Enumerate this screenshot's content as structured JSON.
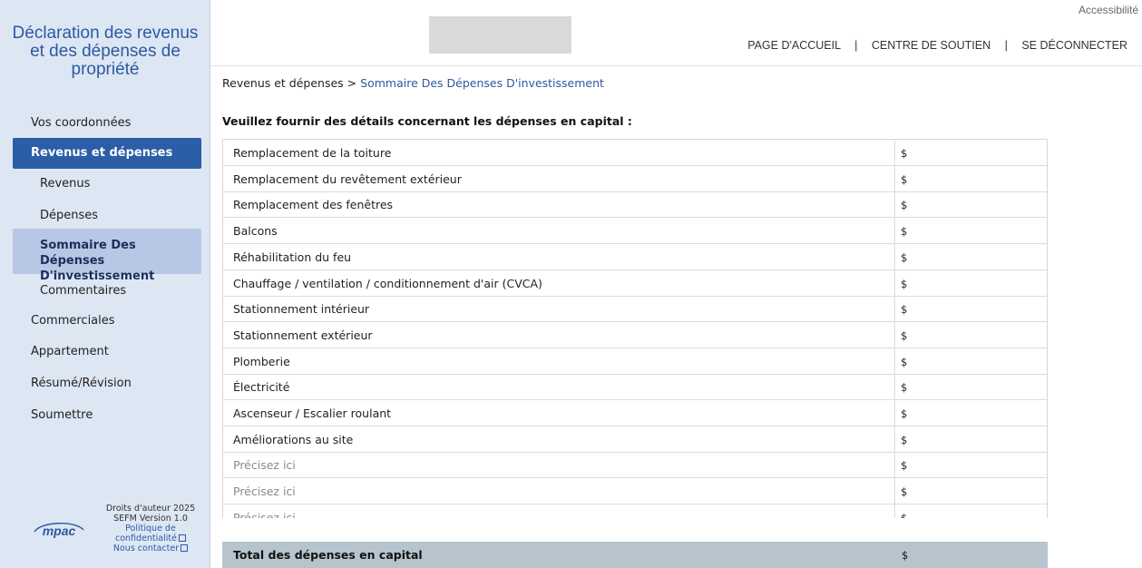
{
  "app": {
    "title_line1": "Déclaration des revenus",
    "title_line2": "et des dépenses de",
    "title_line3": "propriété"
  },
  "header": {
    "accessibility": "Accessibilité",
    "nav": [
      "PAGE D'ACCUEIL",
      "CENTRE DE SOUTIEN",
      "SE DÉCONNECTER"
    ],
    "separator": "|"
  },
  "sidebar": {
    "items": [
      {
        "label": "Vos coordonnées",
        "level": "top",
        "active": false
      },
      {
        "label": "Revenus et dépenses",
        "level": "top",
        "active": true
      },
      {
        "label": "Revenus",
        "level": "sub",
        "active": false
      },
      {
        "label": "Dépenses",
        "level": "sub",
        "active": false
      },
      {
        "label": "Sommaire Des Dépenses D'investissement",
        "level": "sub",
        "active": true
      },
      {
        "label": "Commentaires",
        "level": "sub",
        "active": false
      },
      {
        "label": "Commerciales",
        "level": "top",
        "active": false
      },
      {
        "label": "Appartement",
        "level": "top",
        "active": false
      },
      {
        "label": "Résumé/Révision",
        "level": "top",
        "active": false
      },
      {
        "label": "Soumettre",
        "level": "top",
        "active": false
      }
    ]
  },
  "footer": {
    "logo_text": "mpac",
    "copyright": "Droits d'auteur 2025",
    "version": "SEFM Version 1.0",
    "privacy_line1": "Politique de",
    "privacy_line2": "confidentialité",
    "contact": "Nous contacter"
  },
  "breadcrumb": {
    "parent": "Revenus et dépenses",
    "separator": ">",
    "current": "Sommaire Des Dépenses D'investissement"
  },
  "main": {
    "prompt": "Veuillez fournir des détails concernant les dépenses en capital :",
    "currency": "$",
    "rows": [
      {
        "label": "Remplacement de la toiture",
        "placeholder": false,
        "value": ""
      },
      {
        "label": "Remplacement du revêtement extérieur",
        "placeholder": false,
        "value": ""
      },
      {
        "label": "Remplacement des fenêtres",
        "placeholder": false,
        "value": ""
      },
      {
        "label": "Balcons",
        "placeholder": false,
        "value": ""
      },
      {
        "label": "Réhabilitation du feu",
        "placeholder": false,
        "value": ""
      },
      {
        "label": "Chauffage / ventilation / conditionnement d'air (CVCA)",
        "placeholder": false,
        "value": ""
      },
      {
        "label": "Stationnement intérieur",
        "placeholder": false,
        "value": ""
      },
      {
        "label": "Stationnement extérieur",
        "placeholder": false,
        "value": ""
      },
      {
        "label": "Plomberie",
        "placeholder": false,
        "value": ""
      },
      {
        "label": "Électricité",
        "placeholder": false,
        "value": ""
      },
      {
        "label": "Ascenseur / Escalier roulant",
        "placeholder": false,
        "value": ""
      },
      {
        "label": "Améliorations au site",
        "placeholder": false,
        "value": ""
      },
      {
        "label": "Précisez ici",
        "placeholder": true,
        "value": ""
      },
      {
        "label": "Précisez ici",
        "placeholder": true,
        "value": ""
      },
      {
        "label": "Précisez ici",
        "placeholder": true,
        "value": ""
      }
    ],
    "total_label": "Total des dépenses en capital"
  },
  "colors": {
    "sidebar_bg": "#dde6f3",
    "active_top": "#2b5ea7",
    "active_sub": "#b8c7e6",
    "accent_text": "#2c5aa0",
    "total_row": "#b7c4cd"
  }
}
